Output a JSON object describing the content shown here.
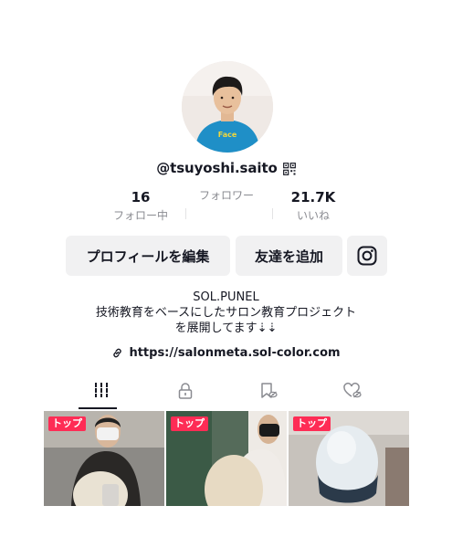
{
  "profile": {
    "username": "@tsuyoshi.saito",
    "avatar_shirt_text": "Face"
  },
  "stats": [
    {
      "value": "16",
      "label": "フォロー中"
    },
    {
      "value": "",
      "label": "フォロワー"
    },
    {
      "value": "21.7K",
      "label": "いいね"
    }
  ],
  "actions": {
    "edit_profile": "プロフィールを編集",
    "add_friend": "友達を追加",
    "instagram_icon": "instagram-icon"
  },
  "bio": {
    "name": "SOL.PUNEL",
    "line1": "技術教育をベースにしたサロン教育プロジェクト",
    "line2": "を展開してます⇣⇣"
  },
  "link": {
    "url": "https://salonmeta.sol-color.com"
  },
  "tabs": [
    {
      "icon": "grid-icon",
      "active": true
    },
    {
      "icon": "lock-icon",
      "active": false
    },
    {
      "icon": "hidden-bookmark-icon",
      "active": false
    },
    {
      "icon": "hidden-heart-icon",
      "active": false
    }
  ],
  "videos": [
    {
      "badge": "トップ"
    },
    {
      "badge": "トップ"
    },
    {
      "badge": "トップ"
    }
  ],
  "colors": {
    "accent": "#fe2c55",
    "text": "#161823",
    "muted": "#8a8b91",
    "button_bg": "#f1f1f2"
  }
}
